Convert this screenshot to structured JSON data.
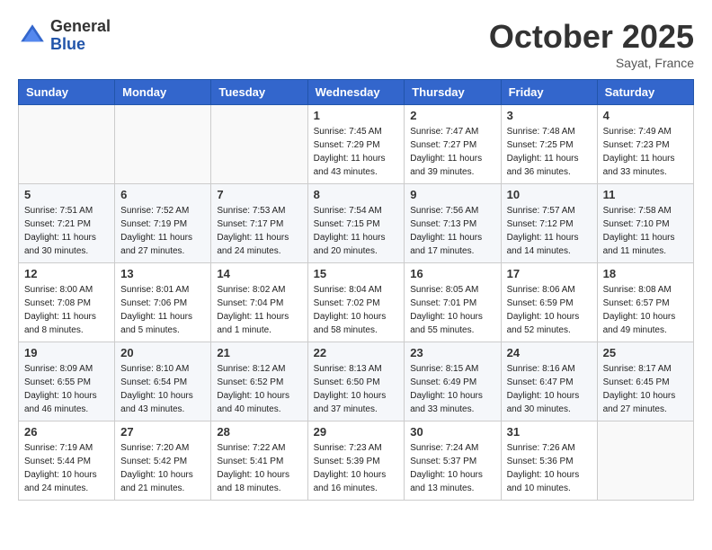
{
  "logo": {
    "general": "General",
    "blue": "Blue"
  },
  "title": "October 2025",
  "location": "Sayat, France",
  "weekdays": [
    "Sunday",
    "Monday",
    "Tuesday",
    "Wednesday",
    "Thursday",
    "Friday",
    "Saturday"
  ],
  "weeks": [
    [
      {
        "day": "",
        "info": ""
      },
      {
        "day": "",
        "info": ""
      },
      {
        "day": "",
        "info": ""
      },
      {
        "day": "1",
        "info": "Sunrise: 7:45 AM\nSunset: 7:29 PM\nDaylight: 11 hours and 43 minutes."
      },
      {
        "day": "2",
        "info": "Sunrise: 7:47 AM\nSunset: 7:27 PM\nDaylight: 11 hours and 39 minutes."
      },
      {
        "day": "3",
        "info": "Sunrise: 7:48 AM\nSunset: 7:25 PM\nDaylight: 11 hours and 36 minutes."
      },
      {
        "day": "4",
        "info": "Sunrise: 7:49 AM\nSunset: 7:23 PM\nDaylight: 11 hours and 33 minutes."
      }
    ],
    [
      {
        "day": "5",
        "info": "Sunrise: 7:51 AM\nSunset: 7:21 PM\nDaylight: 11 hours and 30 minutes."
      },
      {
        "day": "6",
        "info": "Sunrise: 7:52 AM\nSunset: 7:19 PM\nDaylight: 11 hours and 27 minutes."
      },
      {
        "day": "7",
        "info": "Sunrise: 7:53 AM\nSunset: 7:17 PM\nDaylight: 11 hours and 24 minutes."
      },
      {
        "day": "8",
        "info": "Sunrise: 7:54 AM\nSunset: 7:15 PM\nDaylight: 11 hours and 20 minutes."
      },
      {
        "day": "9",
        "info": "Sunrise: 7:56 AM\nSunset: 7:13 PM\nDaylight: 11 hours and 17 minutes."
      },
      {
        "day": "10",
        "info": "Sunrise: 7:57 AM\nSunset: 7:12 PM\nDaylight: 11 hours and 14 minutes."
      },
      {
        "day": "11",
        "info": "Sunrise: 7:58 AM\nSunset: 7:10 PM\nDaylight: 11 hours and 11 minutes."
      }
    ],
    [
      {
        "day": "12",
        "info": "Sunrise: 8:00 AM\nSunset: 7:08 PM\nDaylight: 11 hours and 8 minutes."
      },
      {
        "day": "13",
        "info": "Sunrise: 8:01 AM\nSunset: 7:06 PM\nDaylight: 11 hours and 5 minutes."
      },
      {
        "day": "14",
        "info": "Sunrise: 8:02 AM\nSunset: 7:04 PM\nDaylight: 11 hours and 1 minute."
      },
      {
        "day": "15",
        "info": "Sunrise: 8:04 AM\nSunset: 7:02 PM\nDaylight: 10 hours and 58 minutes."
      },
      {
        "day": "16",
        "info": "Sunrise: 8:05 AM\nSunset: 7:01 PM\nDaylight: 10 hours and 55 minutes."
      },
      {
        "day": "17",
        "info": "Sunrise: 8:06 AM\nSunset: 6:59 PM\nDaylight: 10 hours and 52 minutes."
      },
      {
        "day": "18",
        "info": "Sunrise: 8:08 AM\nSunset: 6:57 PM\nDaylight: 10 hours and 49 minutes."
      }
    ],
    [
      {
        "day": "19",
        "info": "Sunrise: 8:09 AM\nSunset: 6:55 PM\nDaylight: 10 hours and 46 minutes."
      },
      {
        "day": "20",
        "info": "Sunrise: 8:10 AM\nSunset: 6:54 PM\nDaylight: 10 hours and 43 minutes."
      },
      {
        "day": "21",
        "info": "Sunrise: 8:12 AM\nSunset: 6:52 PM\nDaylight: 10 hours and 40 minutes."
      },
      {
        "day": "22",
        "info": "Sunrise: 8:13 AM\nSunset: 6:50 PM\nDaylight: 10 hours and 37 minutes."
      },
      {
        "day": "23",
        "info": "Sunrise: 8:15 AM\nSunset: 6:49 PM\nDaylight: 10 hours and 33 minutes."
      },
      {
        "day": "24",
        "info": "Sunrise: 8:16 AM\nSunset: 6:47 PM\nDaylight: 10 hours and 30 minutes."
      },
      {
        "day": "25",
        "info": "Sunrise: 8:17 AM\nSunset: 6:45 PM\nDaylight: 10 hours and 27 minutes."
      }
    ],
    [
      {
        "day": "26",
        "info": "Sunrise: 7:19 AM\nSunset: 5:44 PM\nDaylight: 10 hours and 24 minutes."
      },
      {
        "day": "27",
        "info": "Sunrise: 7:20 AM\nSunset: 5:42 PM\nDaylight: 10 hours and 21 minutes."
      },
      {
        "day": "28",
        "info": "Sunrise: 7:22 AM\nSunset: 5:41 PM\nDaylight: 10 hours and 18 minutes."
      },
      {
        "day": "29",
        "info": "Sunrise: 7:23 AM\nSunset: 5:39 PM\nDaylight: 10 hours and 16 minutes."
      },
      {
        "day": "30",
        "info": "Sunrise: 7:24 AM\nSunset: 5:37 PM\nDaylight: 10 hours and 13 minutes."
      },
      {
        "day": "31",
        "info": "Sunrise: 7:26 AM\nSunset: 5:36 PM\nDaylight: 10 hours and 10 minutes."
      },
      {
        "day": "",
        "info": ""
      }
    ]
  ]
}
